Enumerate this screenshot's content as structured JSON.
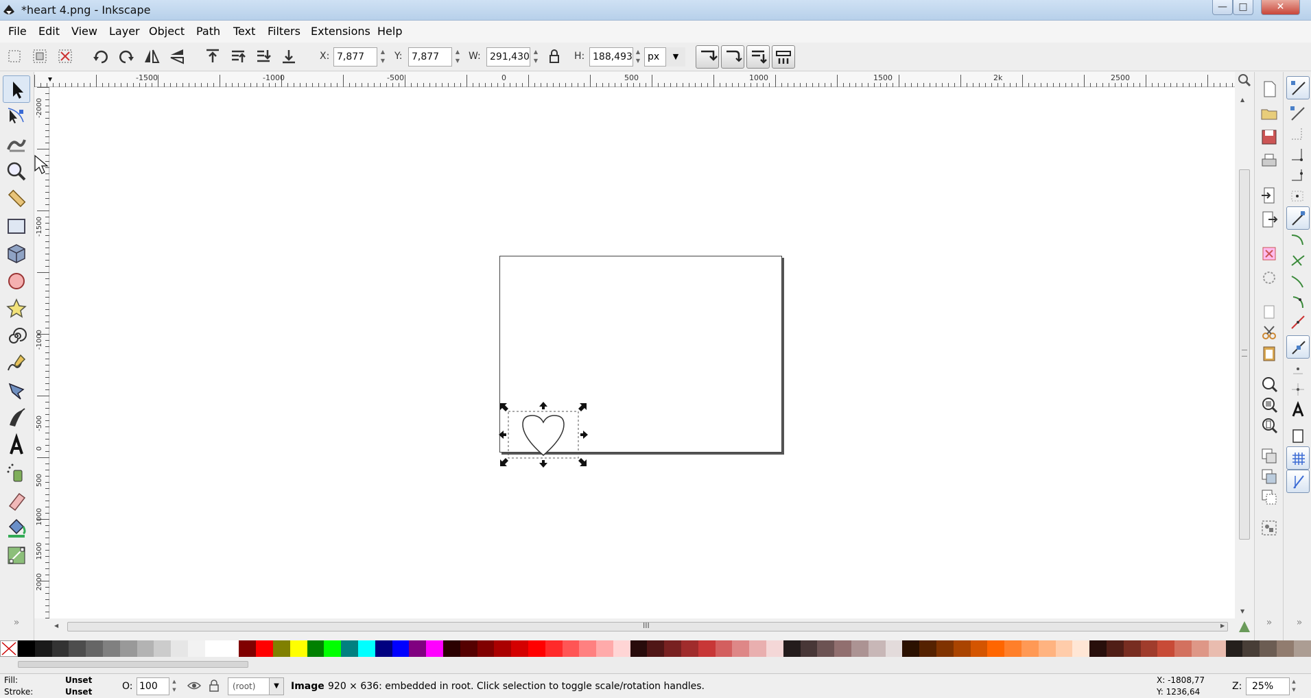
{
  "window": {
    "title": "*heart 4.png - Inkscape",
    "minimize_glyph": "—",
    "maximize_glyph": "□",
    "close_glyph": "✕"
  },
  "menu": [
    "File",
    "Edit",
    "View",
    "Layer",
    "Object",
    "Path",
    "Text",
    "Filters",
    "Extensions",
    "Help"
  ],
  "selector_toolbar": {
    "x_label": "X:",
    "x_value": "7,877",
    "y_label": "Y:",
    "y_value": "7,877",
    "w_label": "W:",
    "w_value": "291,430",
    "h_label": "H:",
    "h_value": "188,493",
    "unit": "px"
  },
  "rulers": {
    "horizontal_ticks": [
      "-1500",
      "-1000",
      "-500",
      "0",
      "500",
      "1000",
      "1500",
      "2k",
      "2500"
    ],
    "vertical_ticks": [
      "-2000",
      "-1500",
      "-1000",
      "-500",
      "0",
      "500",
      "1000",
      "1500",
      "2000"
    ]
  },
  "scroll": {
    "grip_glyph": "III",
    "more_glyph": "»"
  },
  "palette": {
    "colors": [
      "#000000",
      "#1a1a1a",
      "#333333",
      "#4d4d4d",
      "#666666",
      "#808080",
      "#999999",
      "#b3b3b3",
      "#cccccc",
      "#e6e6e6",
      "#f2f2f2",
      "#ffffff",
      "#ffffff",
      "#800000",
      "#ff0000",
      "#808000",
      "#ffff00",
      "#008000",
      "#00ff00",
      "#008080",
      "#00ffff",
      "#000080",
      "#0000ff",
      "#800080",
      "#ff00ff",
      "#2b0000",
      "#550000",
      "#800000",
      "#aa0000",
      "#d40000",
      "#ff0000",
      "#ff2a2a",
      "#ff5555",
      "#ff8080",
      "#ffaaaa",
      "#ffd5d5",
      "#280b0b",
      "#501616",
      "#782121",
      "#a02c2c",
      "#c83737",
      "#d35f5f",
      "#de8787",
      "#e9afaf",
      "#f4d7d7",
      "#241c1c",
      "#483737",
      "#6c5353",
      "#916f6f",
      "#ac9393",
      "#c8b7b7",
      "#e3dbdb",
      "#2b1100",
      "#552200",
      "#803300",
      "#aa4400",
      "#d45500",
      "#ff6600",
      "#ff7f2a",
      "#ff9955",
      "#ffb380",
      "#ffccaa",
      "#ffe6d5",
      "#280f0b",
      "#501e16",
      "#782d21",
      "#a03c2c",
      "#c84b37",
      "#d3715f",
      "#de9787",
      "#e9bcaf",
      "#241f1c",
      "#483e37",
      "#6c5d53",
      "#917c6f",
      "#ac9d93"
    ]
  },
  "status": {
    "fill_label": "Fill:",
    "fill_value": "Unset",
    "stroke_label": "Stroke:",
    "stroke_value": "Unset",
    "opacity_label": "O:",
    "opacity_value": "100",
    "layer": "(root)",
    "message_bold": "Image",
    "message": "920 × 636: embedded in root. Click selection to toggle scale/rotation handles.",
    "coord_x": "X: -1808,77",
    "coord_y": "Y: 1236,64",
    "zoom_label": "Z:",
    "zoom_value": "25%"
  }
}
